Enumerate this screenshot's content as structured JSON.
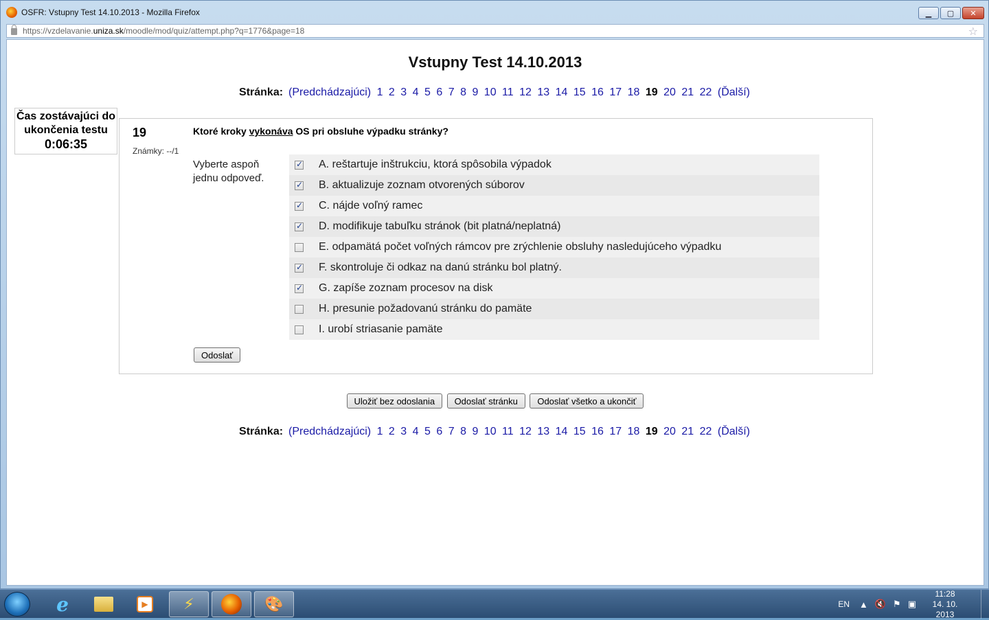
{
  "window": {
    "title": "OSFR: Vstupny Test 14.10.2013 - Mozilla Firefox",
    "url_prefix": "https://vzdelavanie.",
    "url_host": "uniza.sk",
    "url_path": "/moodle/mod/quiz/attempt.php?q=1776&page=18",
    "minimize": "▁",
    "maximize": "▢",
    "close": "✕"
  },
  "page": {
    "title": "Vstupny Test 14.10.2013"
  },
  "pagination": {
    "label": "Stránka:",
    "prev": "(Predchádzajúci)",
    "pages_before": [
      "1",
      "2",
      "3",
      "4",
      "5",
      "6",
      "7",
      "8",
      "9",
      "10",
      "11",
      "12",
      "13",
      "14",
      "15",
      "16",
      "17",
      "18"
    ],
    "current": "19",
    "pages_after": [
      "20",
      "21",
      "22"
    ],
    "next": "(Ďalší)"
  },
  "timer": {
    "label": "Čas zostávajúci do ukončenia testu",
    "time": "0:06:35"
  },
  "question": {
    "number": "19",
    "marks": "Známky: --/1",
    "text_before": "Ktoré kroky ",
    "text_underlined": "vykonáva",
    "text_after": " OS pri obsluhe výpadku stránky?",
    "hint": "Vyberte aspoň jednu odpoveď.",
    "answers": [
      {
        "label": "A. reštartuje inštrukciu, ktorá spôsobila výpadok",
        "checked": true
      },
      {
        "label": "B. aktualizuje zoznam otvorených súborov",
        "checked": true
      },
      {
        "label": "C. nájde voľný ramec",
        "checked": true
      },
      {
        "label": "D. modifikuje tabuľku stránok (bit platná/neplatná)",
        "checked": true
      },
      {
        "label": "E. odpamätá počet voľných rámcov pre zrýchlenie obsluhy nasledujúceho výpadku",
        "checked": false
      },
      {
        "label": "F. skontroluje či odkaz na danú stránku bol platný.",
        "checked": true
      },
      {
        "label": "G. zapíše zoznam procesov na disk",
        "checked": true
      },
      {
        "label": "H. presunie požadovanú stránku do pamäte",
        "checked": false
      },
      {
        "label": "I. urobí striasanie pamäte",
        "checked": false
      }
    ],
    "submit_label": "Odoslať"
  },
  "actions": {
    "save": "Uložiť bez odoslania",
    "submit_page": "Odoslať stránku",
    "submit_all": "Odoslať všetko a ukončiť"
  },
  "taskbar": {
    "lang": "EN",
    "time": "11:28",
    "date": "14. 10. 2013"
  }
}
